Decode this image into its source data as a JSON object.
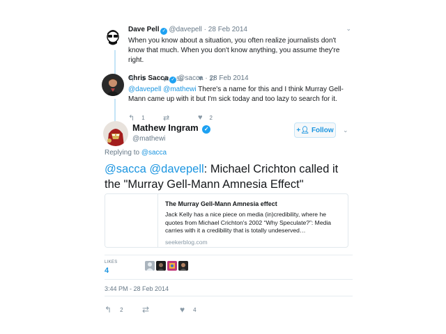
{
  "tweets": [
    {
      "name": "Dave Pell",
      "handle": "@davepell",
      "separator": "·",
      "date": "28 Feb 2014",
      "text": "When you know about a situation, you often realize journalists don't know that much. When you don't know anything, you assume they're right.",
      "reply_count": "3",
      "retweet_count": "55",
      "like_count": "37"
    },
    {
      "name": "Chris Sacca",
      "handle": "@sacca",
      "separator": "·",
      "date": "28 Feb 2014",
      "mentions": "@davepell @mathewi",
      "text": " There's a name for this and I think Murray Gell-Mann came up with it but I'm sick today and too lazy to search for it.",
      "reply_count": "1",
      "retweet_count": "",
      "like_count": "2"
    }
  ],
  "main": {
    "name": "Mathew Ingram",
    "handle": "@mathewi",
    "follow_label": "Follow",
    "replying_prefix": "Replying to ",
    "replying_to": "@sacca",
    "mentions": "@sacca @davepell",
    "text": ": Michael Crichton called it the \"Murray Gell-Mann Amnesia Effect\"",
    "card": {
      "title": "The Murray Gell-Mann Amnesia effect",
      "description": "Jack Kelly has a nice piece on media (in)credibility, where he quotes from Michael Crichton's 2002 “Why Speculate?”: Media carries with it a credibility that is totally undeserved…",
      "domain": "seekerblog.com"
    },
    "likes_label": "LIKES",
    "likes_count": "4",
    "timestamp": "3:44 PM - 28 Feb 2014",
    "reply_count": "2",
    "retweet_count": "",
    "like_count": "4"
  },
  "icons": {
    "reply": "reply-icon",
    "retweet": "retweet-icon",
    "like": "heart-icon",
    "verified": "verified-badge-icon",
    "chevron": "chevron-down-icon",
    "follow": "add-user-icon"
  },
  "colors": {
    "accent": "#1da1f2",
    "link": "#1b95e0",
    "muted": "#657786",
    "thread_line": "#c4e4f7"
  }
}
